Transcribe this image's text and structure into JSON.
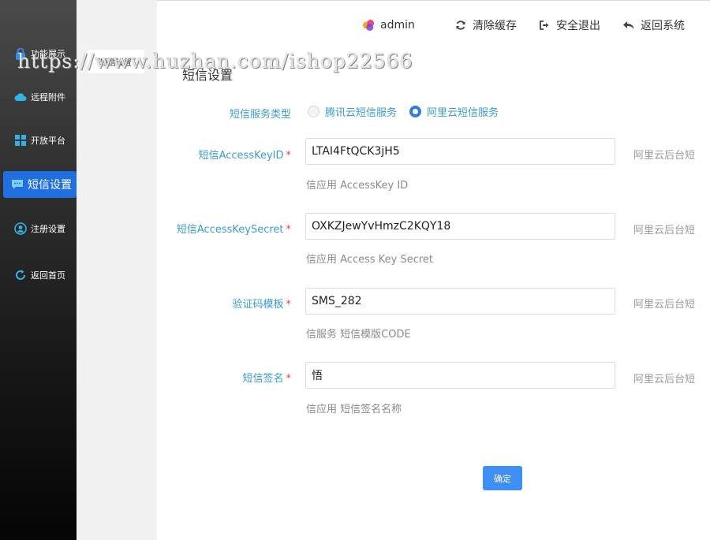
{
  "sidebar": {
    "items": [
      {
        "label": "功能展示",
        "icon": "lock-icon"
      },
      {
        "label": "远程附件",
        "icon": "cloud-icon"
      },
      {
        "label": "开放平台",
        "icon": "grid-icon"
      },
      {
        "label": "短信设置",
        "icon": "message-icon",
        "active": true
      },
      {
        "label": "注册设置",
        "icon": "user-circle-icon"
      },
      {
        "label": "返回首页",
        "icon": "refresh-icon"
      }
    ]
  },
  "subpane": {
    "tab_label": "短信设置"
  },
  "header": {
    "user": "admin",
    "clear_cache": "清除缓存",
    "logout": "安全退出",
    "back": "返回系统"
  },
  "watermark": "https://www.huzhan.com/ishop22566",
  "page_title": "短信设置",
  "form": {
    "service_type": {
      "label": "短信服务类型",
      "options": [
        "腾讯云短信服务",
        "阿里云短信服务"
      ],
      "selected": "阿里云短信服务"
    },
    "access_key_id": {
      "label": "短信AccessKeyID",
      "required": "*",
      "value": "LTAI4FtQCK3jH5",
      "hint": "信应用 AccessKey ID",
      "aside": "阿里云后台短"
    },
    "access_key_secret": {
      "label": "短信AccessKeySecret",
      "required": "*",
      "value": "OXKZJewYvHmzC2KQY18",
      "hint": "信应用 Access Key Secret",
      "aside": "阿里云后台短"
    },
    "template": {
      "label": "验证码模板",
      "required": "*",
      "value": "SMS_282",
      "hint": "信服务 短信模版CODE",
      "aside": "阿里云后台短"
    },
    "signature": {
      "label": "短信签名",
      "required": "*",
      "value": "悟",
      "hint": "信应用 短信签名名称",
      "aside": "阿里云后台短"
    },
    "submit_label": "确定"
  },
  "colors": {
    "accent": "#1f6fe0",
    "label": "#3a9ad9",
    "required": "#e64340",
    "button": "#3f8ef5"
  }
}
